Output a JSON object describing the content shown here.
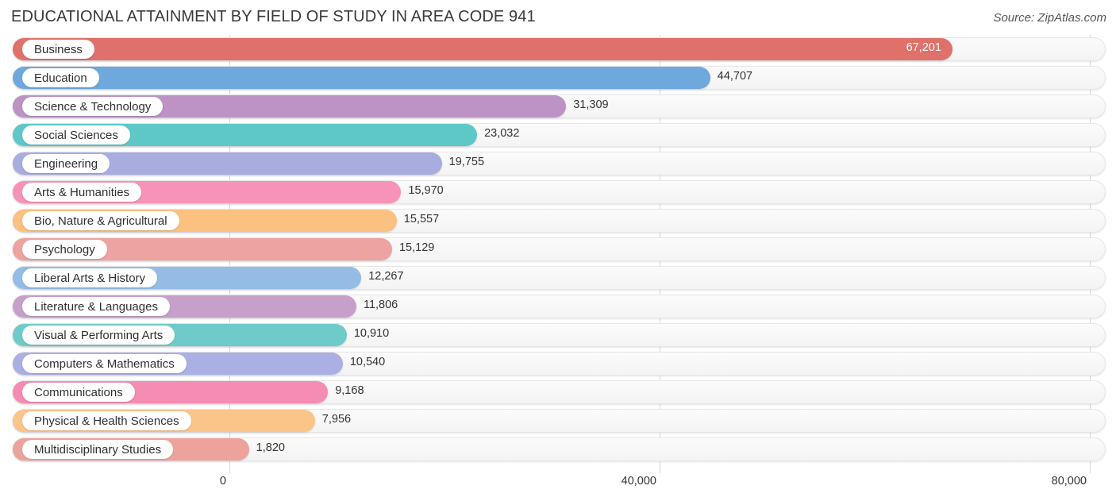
{
  "header": {
    "title": "EDUCATIONAL ATTAINMENT BY FIELD OF STUDY IN AREA CODE 941",
    "source": "Source: ZipAtlas.com"
  },
  "chart_data": {
    "type": "bar",
    "orientation": "horizontal",
    "title": "EDUCATIONAL ATTAINMENT BY FIELD OF STUDY IN AREA CODE 941",
    "xlabel": "",
    "ylabel": "",
    "xlim": [
      0,
      80000
    ],
    "grid": true,
    "legend": "none",
    "xticks": [
      "0",
      "40,000",
      "80,000"
    ],
    "xtick_values": [
      0,
      40000,
      80000
    ],
    "categories": [
      "Business",
      "Education",
      "Science & Technology",
      "Social Sciences",
      "Engineering",
      "Arts & Humanities",
      "Bio, Nature & Agricultural",
      "Psychology",
      "Liberal Arts & History",
      "Literature & Languages",
      "Visual & Performing Arts",
      "Computers & Mathematics",
      "Communications",
      "Physical & Health Sciences",
      "Multidisciplinary Studies"
    ],
    "values": [
      67201,
      44707,
      31309,
      23032,
      19755,
      15970,
      15557,
      15129,
      12267,
      11806,
      10910,
      10540,
      9168,
      7956,
      1820
    ],
    "value_labels": [
      "67,201",
      "44,707",
      "31,309",
      "23,032",
      "19,755",
      "15,970",
      "15,557",
      "15,129",
      "12,267",
      "11,806",
      "10,910",
      "10,540",
      "9,168",
      "7,956",
      "1,820"
    ],
    "colors": [
      "#e0716a",
      "#6fa8dc",
      "#bd93c6",
      "#5ec8c8",
      "#a8acdf",
      "#f792b9",
      "#fbc180",
      "#eda3a0",
      "#94bce5",
      "#c79fcb",
      "#6ecbca",
      "#aab0e4",
      "#f48cb4",
      "#fbc489",
      "#eda39b"
    ]
  }
}
